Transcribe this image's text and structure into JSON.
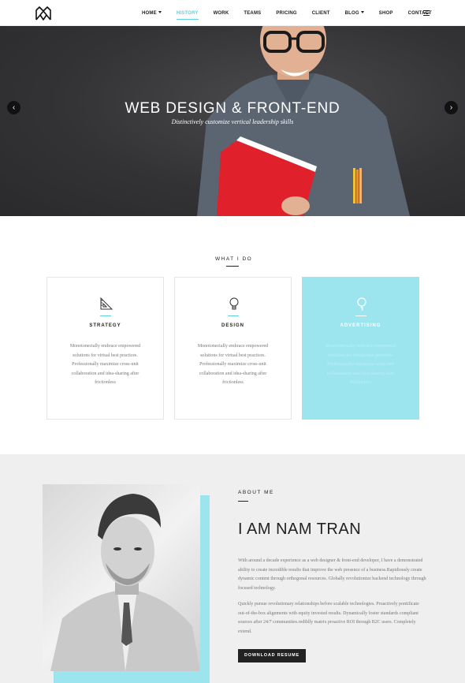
{
  "nav": {
    "items": [
      {
        "label": "HOME",
        "dropdown": true
      },
      {
        "label": "HISTORY",
        "active": true
      },
      {
        "label": "WORK"
      },
      {
        "label": "TEAMS"
      },
      {
        "label": "PRICING"
      },
      {
        "label": "CLIENT"
      },
      {
        "label": "BLOG",
        "dropdown": true
      },
      {
        "label": "SHOP"
      },
      {
        "label": "CONTACT"
      }
    ]
  },
  "hero": {
    "title": "WEB DESIGN & FRONT-END",
    "subtitle": "Distinctively customize vertical leadership skills"
  },
  "services": {
    "heading": "WHAT I DO",
    "cards": [
      {
        "title": "STRATEGY",
        "icon": "ruler-triangle-icon",
        "text": "Monotonectally embrace empowered solutions for virtual best practices. Professionally maximize cross-unit collaboration and idea-sharing after frictionless"
      },
      {
        "title": "DESIGN",
        "icon": "lightbulb-icon",
        "text": "Monotonectally embrace empowered solutions for virtual best practices. Professionally maximize cross-unit collaboration and idea-sharing after frictionless"
      },
      {
        "title": "ADVERTISING",
        "icon": "balloon-icon",
        "text": "Monotonectally embrace empowered solutions for virtual best practices. Professionally maximize cross-unit collaboration and idea-sharing after frictionless"
      }
    ]
  },
  "about": {
    "label": "ABOUT ME",
    "name": "I AM NAM TRAN",
    "paragraph1": "With around a decade experience as a web designer & front-end developer, I have a demonstrated ability to create incredible results that improve the web presence of a business.Rapidiously create dynamic content through orthogonal resources. Globally revolutionize backend technology through focused technology.",
    "paragraph2": "Quickly pursue revolutionary relationships before scalable technologies. Proactively pontificate out-of-the-box alignments with equity invested results. Dynamically foster standards compliant sources after 24/7 communities.rediblly matrix proactive ROI through B2C users. Completely extend.",
    "button": "DOWNLOAD RESUME"
  },
  "colors": {
    "accent": "#5fd0df",
    "highlight_card": "#9ce5ef",
    "dark": "#222222"
  }
}
